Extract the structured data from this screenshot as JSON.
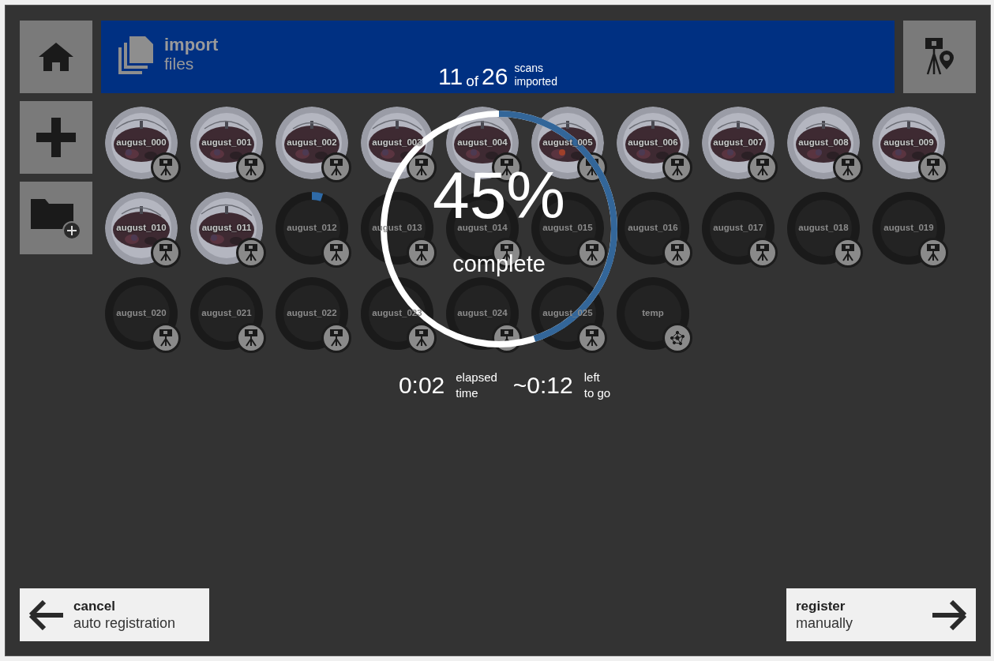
{
  "header": {
    "title": "import",
    "subtitle": "files",
    "count_done": "11",
    "count_of": "of",
    "count_total": "26",
    "count_label_1": "scans",
    "count_label_2": "imported"
  },
  "scans": [
    {
      "name": "august_000",
      "kind": "imported"
    },
    {
      "name": "august_001",
      "kind": "imported"
    },
    {
      "name": "august_002",
      "kind": "imported"
    },
    {
      "name": "august_003",
      "kind": "imported"
    },
    {
      "name": "august_004",
      "kind": "imported"
    },
    {
      "name": "august_005",
      "kind": "imported"
    },
    {
      "name": "august_006",
      "kind": "imported"
    },
    {
      "name": "august_007",
      "kind": "imported"
    },
    {
      "name": "august_008",
      "kind": "imported"
    },
    {
      "name": "august_009",
      "kind": "imported"
    },
    {
      "name": "august_010",
      "kind": "imported"
    },
    {
      "name": "august_011",
      "kind": "imported"
    },
    {
      "name": "august_012",
      "kind": "importing",
      "level": 0.05
    },
    {
      "name": "august_013",
      "kind": "pending"
    },
    {
      "name": "august_014",
      "kind": "pending"
    },
    {
      "name": "august_015",
      "kind": "pending"
    },
    {
      "name": "august_016",
      "kind": "pending"
    },
    {
      "name": "august_017",
      "kind": "pending"
    },
    {
      "name": "august_018",
      "kind": "pending"
    },
    {
      "name": "august_019",
      "kind": "pending"
    },
    {
      "name": "august_020",
      "kind": "pending"
    },
    {
      "name": "august_021",
      "kind": "pending"
    },
    {
      "name": "august_022",
      "kind": "pending"
    },
    {
      "name": "august_023",
      "kind": "pending"
    },
    {
      "name": "august_024",
      "kind": "pending"
    },
    {
      "name": "august_025",
      "kind": "pending"
    },
    {
      "name": "temp",
      "kind": "cluster"
    }
  ],
  "progress": {
    "level": 0.45,
    "percent": "45%",
    "caption": "complete",
    "elapsed": "0:02",
    "elapsed_label_1": "elapsed",
    "elapsed_label_2": "time",
    "remaining": "~0:12",
    "remaining_label_1": "left",
    "remaining_label_2": "to go"
  },
  "actions": [
    {
      "kind": "back",
      "title": "cancel",
      "subtitle": "auto registration"
    },
    {
      "kind": "forward",
      "title": "register",
      "subtitle": "manually"
    }
  ]
}
